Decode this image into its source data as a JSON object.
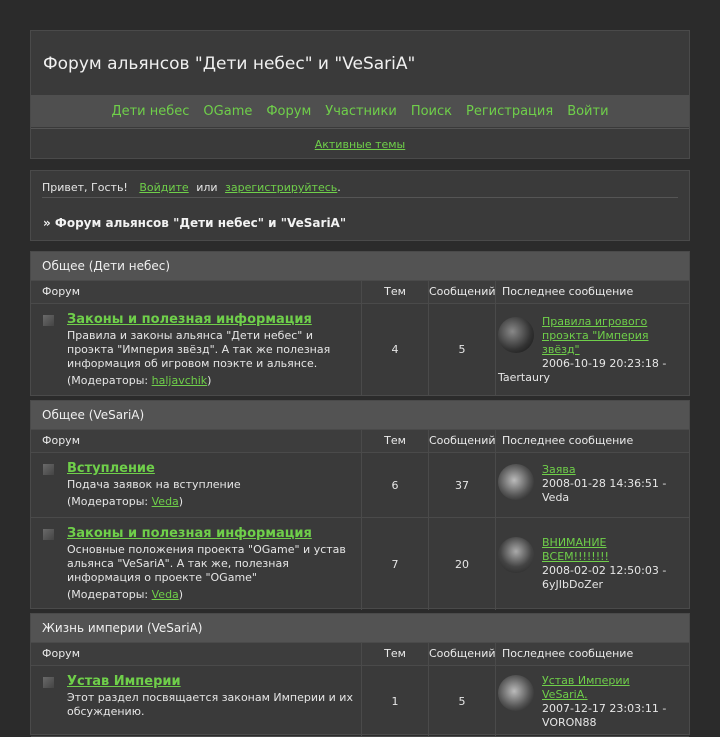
{
  "header": {
    "title": "Форум альянсов \"Дети небес\" и \"VeSariA\"",
    "nav": [
      "Дети небес",
      "OGame",
      "Форум",
      "Участники",
      "Поиск",
      "Регистрация",
      "Войти"
    ],
    "subnav": "Активные темы"
  },
  "welcome": {
    "greeting": "Привет, Гость!",
    "login": "Войдите",
    "or": "или",
    "register": "зарегистрируйтесь",
    "breadcrumb": "» Форум альянсов \"Дети небес\" и \"VeSariA\""
  },
  "columns": {
    "forum": "Форум",
    "topics": "Тем",
    "posts": "Сообщений",
    "last": "Последнее сообщение"
  },
  "categories": [
    {
      "title": "Общее (Дети небес)",
      "forums": [
        {
          "name": "Законы и полезная информация",
          "desc": "Правила и законы альянса \"Дети небес\" и проэкта \"Империя звёзд\". А так же полезная информация об игровом поэкте и альянсе.",
          "mod_prefix": "(Модераторы:",
          "mod": "haljavchik",
          "mod_suffix": ")",
          "topics": "4",
          "posts": "5",
          "last_title": "Правила игрового проэкта \"Империя звёзд\"",
          "last_meta": "2006-10-19 20:23:18 - Taertaury"
        }
      ]
    },
    {
      "title": "Общее (VeSariA)",
      "forums": [
        {
          "name": "Вступление",
          "desc": "Подача заявок на вступление",
          "mod_prefix": "(Модераторы:",
          "mod": "Veda",
          "mod_suffix": ")",
          "topics": "6",
          "posts": "37",
          "last_title": "Заява",
          "last_meta": "2008-01-28 14:36:51 - Veda"
        },
        {
          "name": "Законы и полезная информация",
          "desc": "Основные положения проекта \"OGame\" и устав альянса \"VeSariA\". А так же, полезная информация о проекте \"OGame\"",
          "mod_prefix": "(Модераторы:",
          "mod": "Veda",
          "mod_suffix": ")",
          "topics": "7",
          "posts": "20",
          "last_title": "ВНИМАНИЕ ВСЕМ!!!!!!!!",
          "last_meta": "2008-02-02 12:50:03 - 6yJIbDoZer"
        }
      ]
    },
    {
      "title": "Жизнь империи (VeSariA)",
      "forums": [
        {
          "name": "Устав Империи",
          "desc": "Этот раздел посвящается законам Империи и их обсуждению.",
          "topics": "1",
          "posts": "5",
          "last_title": "Устав Империи VeSariA.",
          "last_meta": "2007-12-17 23:03:11 - VORON88"
        }
      ]
    }
  ]
}
